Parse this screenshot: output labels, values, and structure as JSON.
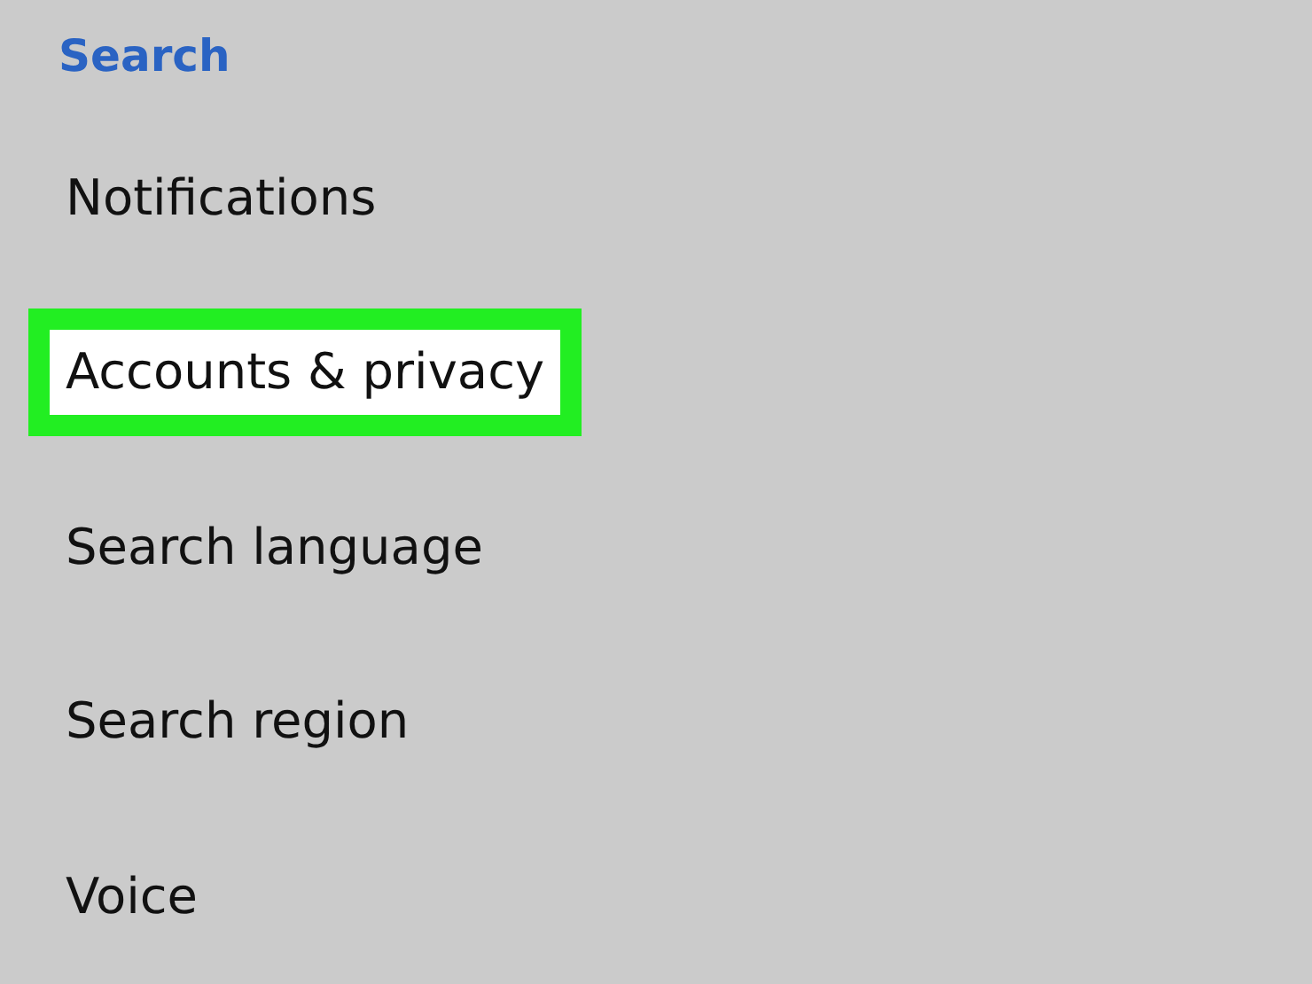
{
  "section_header": "Search",
  "items": [
    {
      "label": "Notifications",
      "highlighted": false
    },
    {
      "label": "Accounts & privacy",
      "highlighted": true
    },
    {
      "label": "Search language",
      "highlighted": false
    },
    {
      "label": "Search region",
      "highlighted": false
    },
    {
      "label": "Voice",
      "highlighted": false
    }
  ]
}
